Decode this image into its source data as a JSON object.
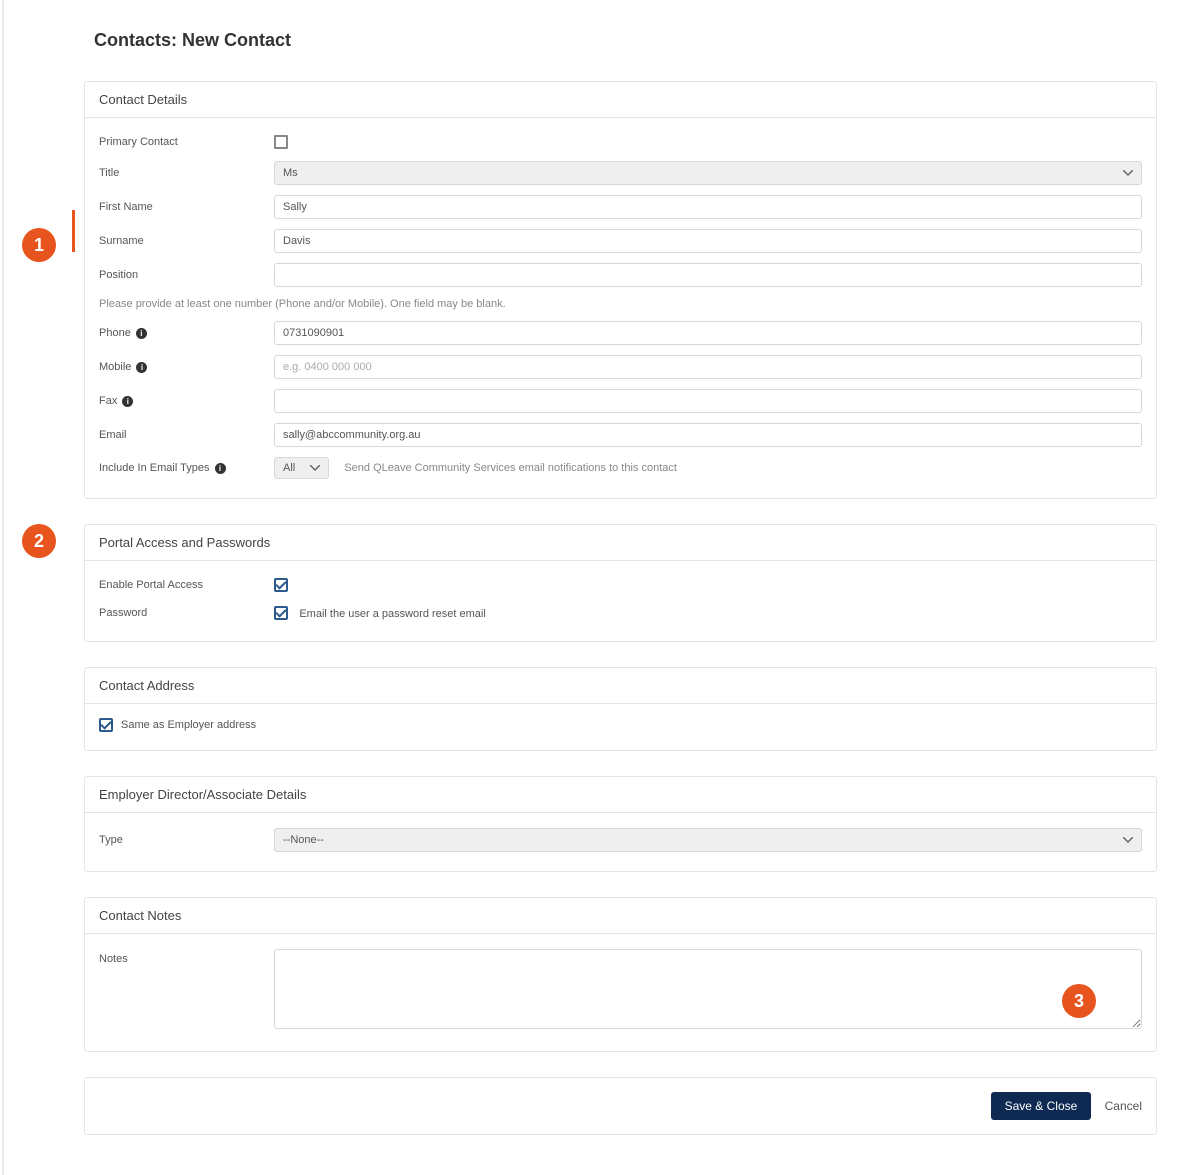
{
  "page_title": "Contacts: New Contact",
  "sections": {
    "contact_details": {
      "header": "Contact Details",
      "primary_contact_label": "Primary Contact",
      "primary_contact_checked": false,
      "title_label": "Title",
      "title_value": "Ms",
      "first_name_label": "First Name",
      "first_name_value": "Sally",
      "surname_label": "Surname",
      "surname_value": "Davis",
      "position_label": "Position",
      "position_value": "",
      "phone_help": "Please provide at least one number (Phone and/or Mobile). One field may be blank.",
      "phone_label": "Phone",
      "phone_value": "0731090901",
      "mobile_label": "Mobile",
      "mobile_placeholder": "e.g. 0400 000 000",
      "fax_label": "Fax",
      "fax_value": "",
      "email_label": "Email",
      "email_value": "sally@abccommunity.org.au",
      "include_email_label": "Include In Email Types",
      "include_email_value": "All",
      "include_email_help": "Send QLeave Community Services email notifications to this contact"
    },
    "portal": {
      "header": "Portal Access and Passwords",
      "enable_label": "Enable Portal Access",
      "enable_checked": true,
      "password_label": "Password",
      "password_reset_checked": true,
      "password_reset_text": "Email the user a password reset email"
    },
    "address": {
      "header": "Contact Address",
      "same_as_employer_checked": true,
      "same_as_employer_label": "Same as Employer address"
    },
    "director": {
      "header": "Employer Director/Associate Details",
      "type_label": "Type",
      "type_value": "--None--"
    },
    "notes": {
      "header": "Contact Notes",
      "notes_label": "Notes",
      "notes_value": ""
    }
  },
  "actions": {
    "save_label": "Save & Close",
    "cancel_label": "Cancel"
  },
  "markers": {
    "one": "1",
    "two": "2",
    "three": "3"
  }
}
